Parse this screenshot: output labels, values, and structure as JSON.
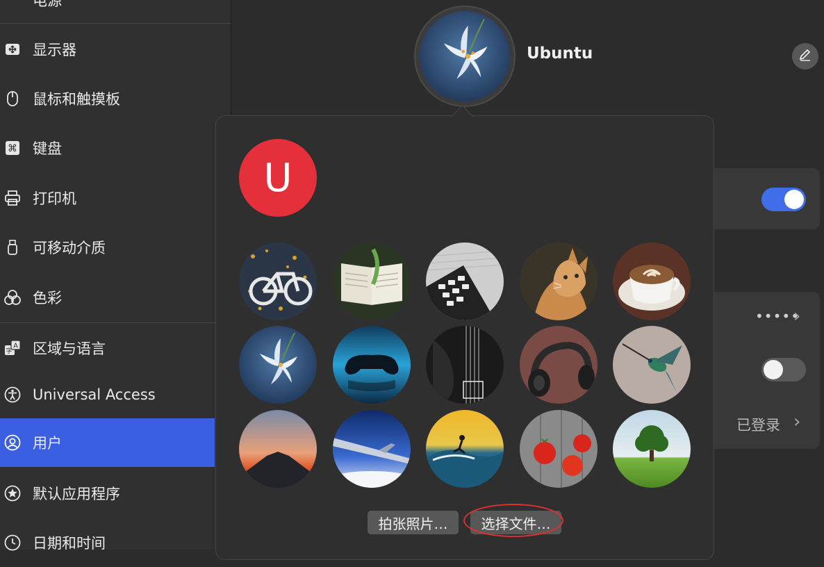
{
  "sidebar": {
    "items": [
      {
        "label": "电源",
        "icon": "power-icon"
      },
      {
        "label": "显示器",
        "icon": "display-icon"
      },
      {
        "label": "鼠标和触摸板",
        "icon": "mouse-icon"
      },
      {
        "label": "键盘",
        "icon": "keyboard-icon"
      },
      {
        "label": "打印机",
        "icon": "printer-icon"
      },
      {
        "label": "可移动介质",
        "icon": "removable-media-icon"
      },
      {
        "label": "色彩",
        "icon": "color-icon"
      },
      {
        "label": "区域与语言",
        "icon": "region-language-icon"
      },
      {
        "label": "Universal Access",
        "icon": "accessibility-icon"
      },
      {
        "label": "用户",
        "icon": "user-icon",
        "active": true
      },
      {
        "label": "默认应用程序",
        "icon": "default-apps-icon"
      },
      {
        "label": "日期和时间",
        "icon": "clock-icon"
      }
    ]
  },
  "user": {
    "name": "Ubuntu",
    "login_status": "已登录",
    "password_mask": "•••••"
  },
  "popover": {
    "letter_avatar": "U",
    "avatar_options": [
      "bicycle",
      "book",
      "calculator",
      "cat",
      "coffee",
      "lily",
      "gamepad",
      "guitar",
      "headphones",
      "hummingbird",
      "mountain",
      "plane-wing",
      "surfer",
      "tomatoes",
      "tree"
    ],
    "take_photo_label": "拍张照片…",
    "choose_file_label": "选择文件…"
  },
  "colors": {
    "accent": "#3a5fe0",
    "letter_avatar_bg": "#e5303c",
    "highlight": "#e03030"
  }
}
